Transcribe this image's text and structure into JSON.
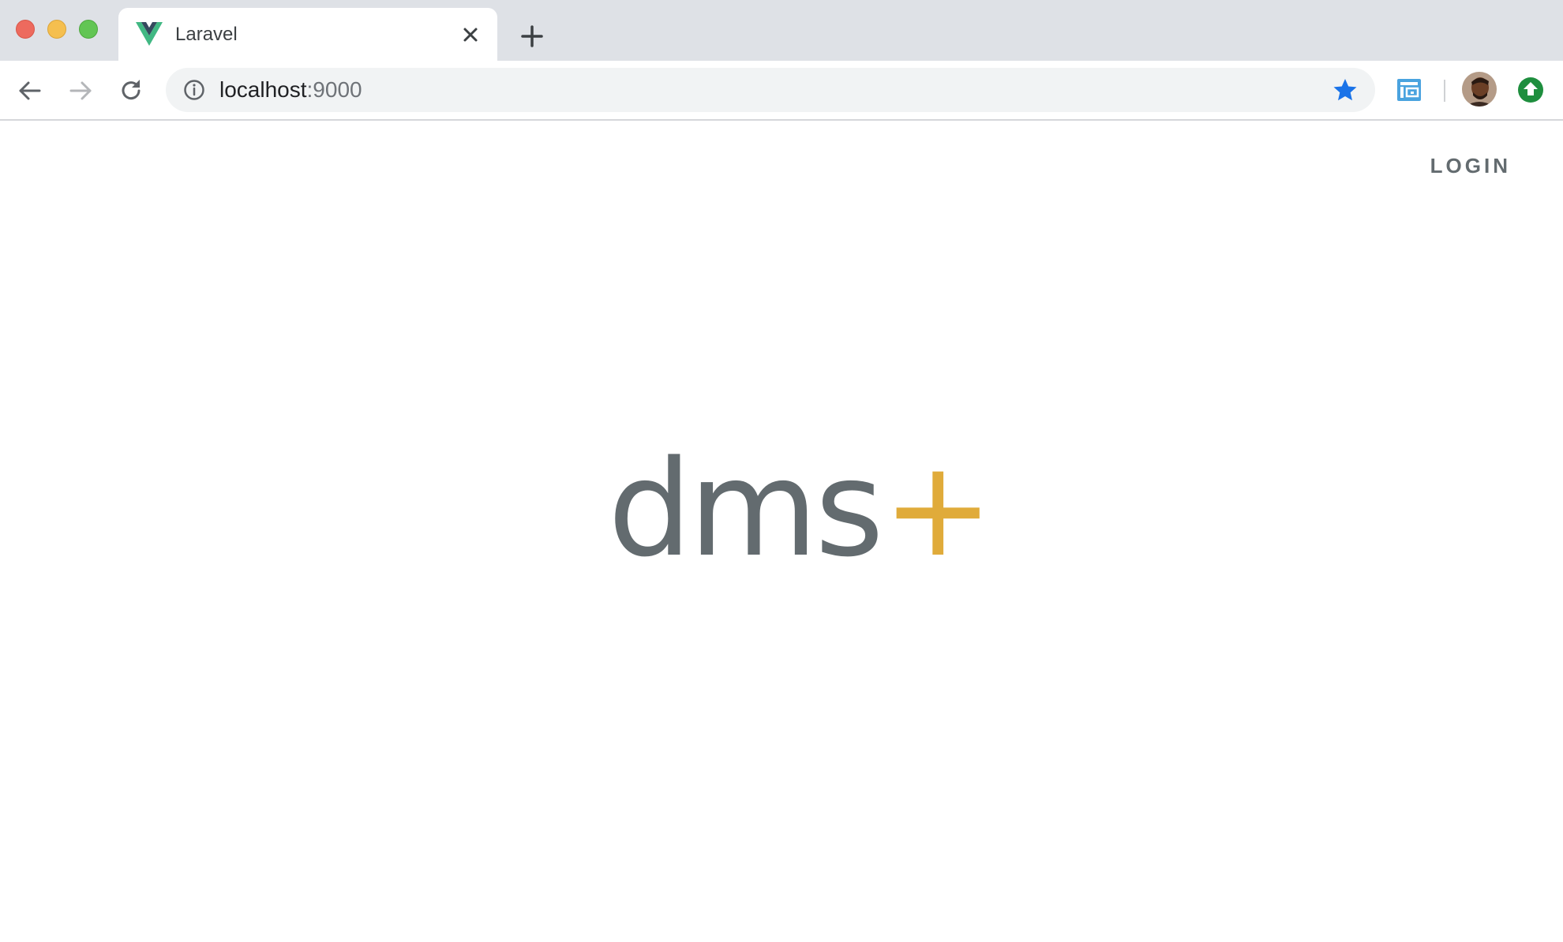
{
  "browser": {
    "tab": {
      "title": "Laravel",
      "favicon": "vue-logo-icon"
    },
    "address_bar": {
      "host": "localhost",
      "port": ":9000"
    },
    "colors": {
      "tab_strip": "#dee1e6",
      "star": "#1a73e8",
      "update": "#1e8e3e"
    }
  },
  "page": {
    "nav": {
      "login_label": "LOGIN"
    },
    "logo": {
      "text": "dms",
      "accent": "+",
      "text_color": "#636b6f",
      "accent_color": "#e0ab3a"
    }
  }
}
